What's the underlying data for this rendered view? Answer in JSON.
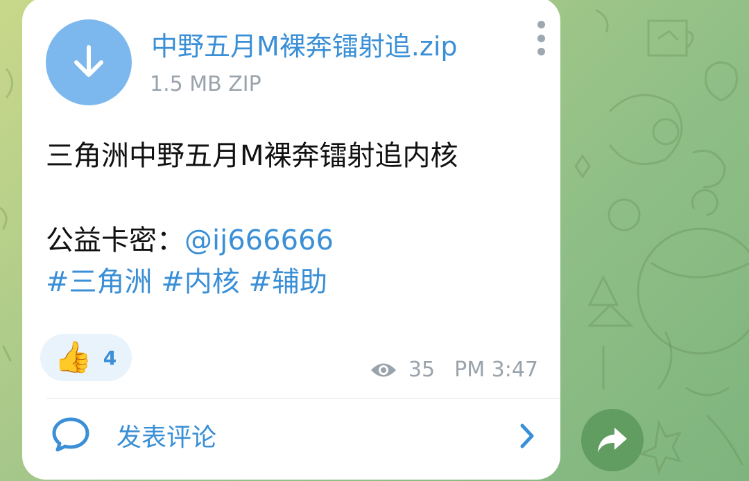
{
  "file": {
    "name": "中野五月M裸奔镭射追.zip",
    "size": "1.5 MB ZIP",
    "icon": "download-arrow-icon"
  },
  "message": {
    "line1": "三角洲中野五月M裸奔镭射追内核",
    "key_label": "公益卡密：",
    "key_link": "@ij666666",
    "tags": [
      "#三角洲",
      "#内核",
      "#辅助"
    ]
  },
  "reaction": {
    "emoji": "👍",
    "count": "4"
  },
  "meta": {
    "views": "35",
    "time": "PM 3:47"
  },
  "comments": {
    "label": "发表评论"
  },
  "colors": {
    "accent": "#3a8fd6",
    "file_icon_bg": "#7cb8ee",
    "meta_gray": "#9aa3ab",
    "share_bg": "#5a965a"
  }
}
